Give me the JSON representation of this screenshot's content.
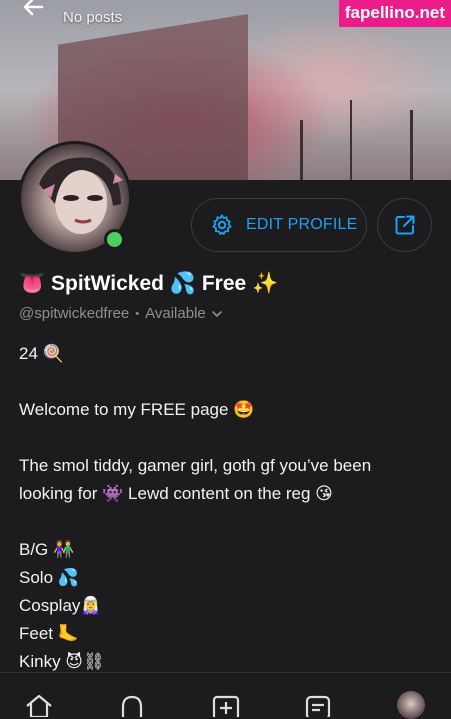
{
  "header": {
    "subtitle": "No posts"
  },
  "watermark": "fapellino.net",
  "profile": {
    "display_name": "SpitWicked",
    "name_suffix": "Free",
    "name_lead_emoji": "👅",
    "name_mid_emoji": "💦",
    "name_tail_emoji": "✨",
    "handle": "@spitwickedfree",
    "separator": "•",
    "status": "Available",
    "online": true
  },
  "actions": {
    "edit_label": "EDIT PROFILE"
  },
  "bio": {
    "line1": "24 🍭",
    "line2": "Welcome to my FREE page 🤩",
    "line3": "The smol tiddy, gamer girl, goth gf you’ve been",
    "line4": "looking for 👾 Lewd content on the reg 😘",
    "line5": "B/G 👫",
    "line6": "Solo 💦",
    "line7": "Cosplay🧝‍♀️",
    "line8": "Feet 🦶",
    "line9": "Kinky 😈⛓"
  },
  "colors": {
    "accent": "#1da1f2",
    "background": "#1c1c1e",
    "online": "#4ccf5f",
    "watermark_bg": "#ec1d8a"
  },
  "nav_icons": [
    "home-icon",
    "bell-icon",
    "add-post-icon",
    "messages-icon",
    "profile-avatar"
  ]
}
